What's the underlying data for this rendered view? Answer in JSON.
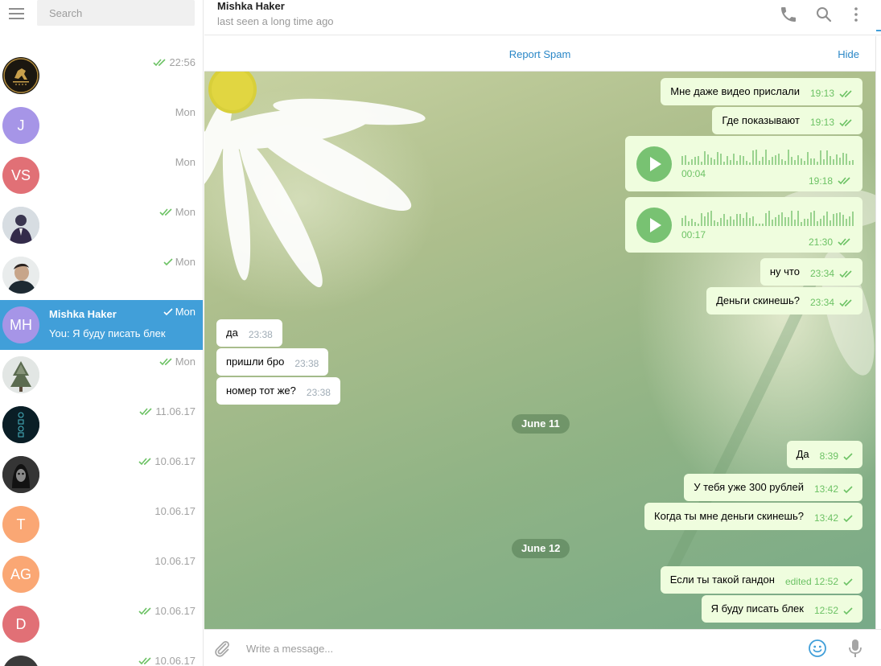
{
  "sidebar": {
    "search_placeholder": "Search",
    "chats": [
      {
        "time": ""
      },
      {
        "initials": "",
        "time": "22:56",
        "checks": "double"
      },
      {
        "initials": "J",
        "color": "#a695e7",
        "time": "Mon",
        "checks": "none"
      },
      {
        "initials": "VS",
        "color": "#e17076",
        "time": "Mon",
        "checks": "none"
      },
      {
        "initials": "",
        "time": "Mon",
        "checks": "double"
      },
      {
        "initials": "",
        "time": "Mon",
        "checks": "single"
      },
      {
        "initials": "MH",
        "color": "#a695e7",
        "name": "Mishka Haker",
        "preview": "You: Я буду писать блек",
        "time": "Mon",
        "checks": "single",
        "active": true
      },
      {
        "initials": "",
        "time": "Mon",
        "checks": "double"
      },
      {
        "initials": "",
        "time": "11.06.17",
        "checks": "double"
      },
      {
        "initials": "",
        "time": "10.06.17",
        "checks": "double"
      },
      {
        "initials": "T",
        "color": "#faa774",
        "time": "10.06.17",
        "checks": "none"
      },
      {
        "initials": "AG",
        "color": "#faa774",
        "time": "10.06.17",
        "checks": "none"
      },
      {
        "initials": "D",
        "color": "#e17076",
        "time": "10.06.17",
        "checks": "double"
      },
      {
        "initials": "",
        "time": "10.06.17",
        "checks": "double"
      }
    ]
  },
  "header": {
    "name": "Mishka Haker",
    "status": "last seen a long time ago"
  },
  "spam_bar": {
    "report": "Report Spam",
    "hide": "Hide"
  },
  "messages": [
    {
      "type": "out",
      "text": "Мне даже видео прислали",
      "time": "19:13",
      "checks": "double"
    },
    {
      "type": "out",
      "text": "Где показывают",
      "time": "19:13",
      "checks": "double"
    },
    {
      "type": "voice",
      "duration": "00:04",
      "time": "19:18",
      "checks": "double"
    },
    {
      "type": "voice",
      "duration": "00:17",
      "time": "21:30",
      "checks": "double"
    },
    {
      "type": "out",
      "text": "ну что",
      "time": "23:34",
      "checks": "double"
    },
    {
      "type": "out",
      "text": "Деньги скинешь?",
      "time": "23:34",
      "checks": "double"
    },
    {
      "type": "in",
      "text": "да",
      "time": "23:38"
    },
    {
      "type": "in",
      "text": "пришли бро",
      "time": "23:38"
    },
    {
      "type": "in",
      "text": "номер тот же?",
      "time": "23:38"
    },
    {
      "type": "date",
      "text": "June 11"
    },
    {
      "type": "out",
      "text": "Да",
      "time": "8:39",
      "checks": "single"
    },
    {
      "type": "out",
      "text": "У тебя уже 300 рублей",
      "time": "13:42",
      "checks": "single"
    },
    {
      "type": "out",
      "text": "Когда ты мне деньги скинешь?",
      "time": "13:42",
      "checks": "single"
    },
    {
      "type": "date",
      "text": "June 12"
    },
    {
      "type": "out",
      "text": "Если ты такой гандон",
      "time": "edited 12:52",
      "checks": "single"
    },
    {
      "type": "out",
      "text": "Я буду писать блек",
      "time": "12:52",
      "checks": "single"
    }
  ],
  "composer": {
    "placeholder": "Write a message..."
  },
  "colors": {
    "accent": "#419fd9",
    "check": "#6cc264",
    "out_bubble": "#effdde"
  }
}
